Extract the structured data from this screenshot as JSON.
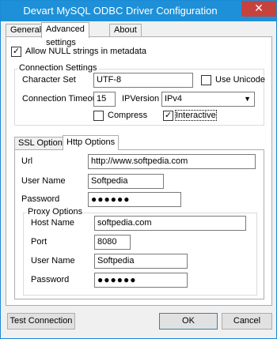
{
  "window": {
    "title": "Devart MySQL ODBC Driver Configuration",
    "close_glyph": "✕"
  },
  "tabs": [
    {
      "label": "General"
    },
    {
      "label": "Advanced settings"
    },
    {
      "label": "About"
    }
  ],
  "advanced": {
    "allow_null_label": "Allow NULL strings in metadata",
    "allow_null_checked": true,
    "connection_settings": {
      "group_title": "Connection Settings",
      "charset_label": "Character Set",
      "charset_value": "UTF-8",
      "use_unicode_label": "Use Unicode",
      "use_unicode_checked": false,
      "timeout_label": "Connection Timeout",
      "timeout_value": "15",
      "ipversion_label": "IPVersion",
      "ipversion_value": "IPv4",
      "compress_label": "Compress",
      "compress_checked": false,
      "interactive_label": "Interactive",
      "interactive_checked": true
    },
    "subtabs": [
      {
        "label": "SSL Options"
      },
      {
        "label": "Http Options"
      }
    ],
    "http": {
      "url_label": "Url",
      "url_value": "http://www.softpedia.com",
      "user_label": "User Name",
      "user_value": "Softpedia",
      "password_label": "Password",
      "password_value": "●●●●●●",
      "proxy": {
        "group_title": "Proxy Options",
        "host_label": "Host Name",
        "host_value": "softpedia.com",
        "port_label": "Port",
        "port_value": "8080",
        "user_label": "User Name",
        "user_value": "Softpedia",
        "password_label": "Password",
        "password_value": "●●●●●●"
      }
    }
  },
  "buttons": {
    "test_connection": "Test Connection",
    "ok": "OK",
    "cancel": "Cancel"
  },
  "colors": {
    "titlebar": "#1e90d8",
    "close": "#c7423d"
  }
}
